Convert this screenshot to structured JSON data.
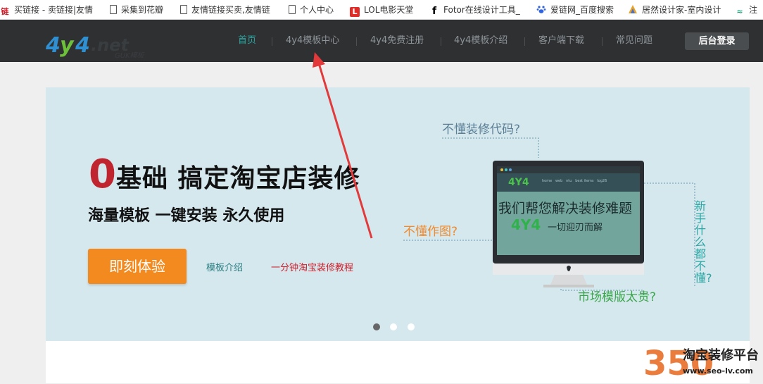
{
  "bookmarks": [
    {
      "icon": "链",
      "label": "买链接 - 卖链接|友情"
    },
    {
      "icon": "",
      "label": "采集到花瓣"
    },
    {
      "icon": "",
      "label": "友情链接买卖,友情链"
    },
    {
      "icon": "",
      "label": "个人中心"
    },
    {
      "icon": "L",
      "label": "LOL电影天堂"
    },
    {
      "icon": "f",
      "label": "Fotor在线设计工具_"
    },
    {
      "icon": "",
      "label": "爱链网_百度搜索"
    },
    {
      "icon": "",
      "label": "居然设计家-室内设计"
    },
    {
      "icon": "",
      "label": "注"
    }
  ],
  "nav": {
    "logo_text": "4y4.net",
    "logo_sub": "GUK模板",
    "items": [
      "首页",
      "4y4模板中心",
      "4y4免费注册",
      "4y4模板介绍",
      "客户端下载",
      "常见问题"
    ],
    "login": "后台登录"
  },
  "banner": {
    "zero": "0",
    "headline": "基础 搞定淘宝店装修",
    "subline": "海量模板 一键安装 永久使用",
    "try_button": "即刻体验",
    "link_intro": "模板介绍",
    "link_tutorial": "一分钟淘宝装修教程",
    "q1": "不懂装修代码?",
    "q2": "不懂作图?",
    "q3": "市场模版太贵?",
    "q4": "新手什么都不懂?",
    "screen_brand": "4Y4",
    "screen_line1": "我们帮您解决装修难题",
    "screen_brand2": "4Y4",
    "screen_line2": "一切迎刃而解",
    "screen_menu": [
      "home",
      "web",
      "ntu",
      "best items",
      "log26"
    ]
  },
  "watermark": {
    "num": "350",
    "title": "淘宝装修平台",
    "url": "www.seo-lv.com"
  },
  "colors": {
    "accent": "#2ba6a3",
    "nav_bg": "#2e3032",
    "banner_bg": "#d5e8ee",
    "orange": "#f28a1f",
    "red": "#c0242f"
  }
}
